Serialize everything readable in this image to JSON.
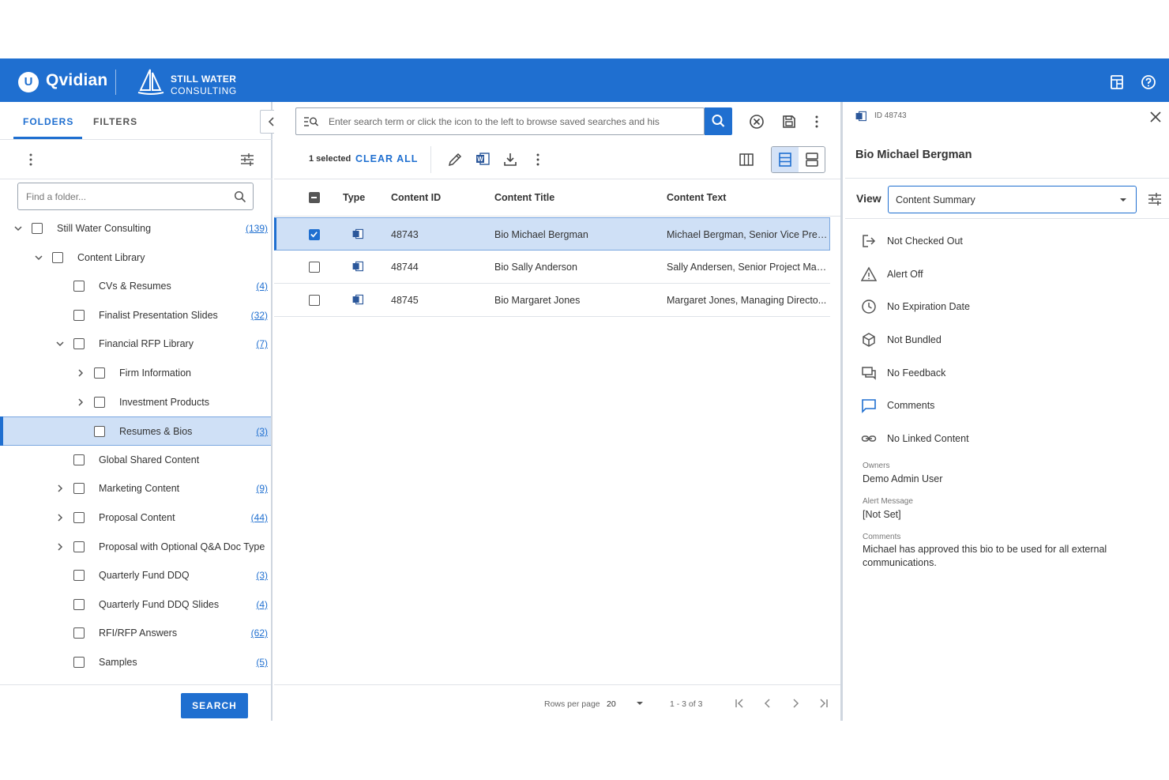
{
  "header": {
    "brand": "Qvidian",
    "logo_letter": "U",
    "partner_line1": "STILL WATER",
    "partner_line2": "CONSULTING",
    "icons": [
      "calculator-icon",
      "help-icon"
    ]
  },
  "left_panel": {
    "tabs": [
      {
        "label": "FOLDERS",
        "active": true
      },
      {
        "label": "FILTERS",
        "active": false
      }
    ],
    "folder_search_placeholder": "Find a folder...",
    "tree": [
      {
        "label": "Still Water Consulting",
        "count": "(139)",
        "level": 0,
        "chevron": "down"
      },
      {
        "label": "Content Library",
        "count": "",
        "level": 1,
        "chevron": "down"
      },
      {
        "label": "CVs & Resumes",
        "count": "(4)",
        "level": 2,
        "chevron": ""
      },
      {
        "label": "Finalist Presentation Slides",
        "count": "(32)",
        "level": 2,
        "chevron": ""
      },
      {
        "label": "Financial RFP Library",
        "count": "(7)",
        "level": 2,
        "chevron": "down"
      },
      {
        "label": "Firm Information",
        "count": "",
        "level": 3,
        "chevron": "right"
      },
      {
        "label": "Investment Products",
        "count": "",
        "level": 3,
        "chevron": "right"
      },
      {
        "label": "Resumes & Bios",
        "count": "(3)",
        "level": 3,
        "chevron": "",
        "selected": true
      },
      {
        "label": "Global Shared Content",
        "count": "",
        "level": 2,
        "chevron": ""
      },
      {
        "label": "Marketing Content",
        "count": "(9)",
        "level": 2,
        "chevron": "right"
      },
      {
        "label": "Proposal Content",
        "count": "(44)",
        "level": 2,
        "chevron": "right"
      },
      {
        "label": "Proposal with Optional Q&A Doc Type",
        "count": "",
        "level": 2,
        "chevron": "right"
      },
      {
        "label": "Quarterly Fund DDQ",
        "count": "(3)",
        "level": 2,
        "chevron": ""
      },
      {
        "label": "Quarterly Fund DDQ Slides",
        "count": "(4)",
        "level": 2,
        "chevron": ""
      },
      {
        "label": "RFI/RFP Answers",
        "count": "(62)",
        "level": 2,
        "chevron": ""
      },
      {
        "label": "Samples",
        "count": "(5)",
        "level": 2,
        "chevron": ""
      }
    ],
    "search_button": "SEARCH"
  },
  "middle_panel": {
    "search_placeholder": "Enter search term or click the icon to the left to browse saved searches and his",
    "selected_text": "1 selected",
    "clear_all": "CLEAR ALL",
    "columns": [
      "Type",
      "Content ID",
      "Content Title",
      "Content Text"
    ],
    "rows": [
      {
        "type_icon": "word-doc-icon",
        "id": "48743",
        "title": "Bio Michael Bergman",
        "text": "Michael Bergman, Senior Vice Pres...",
        "checked": true
      },
      {
        "type_icon": "word-doc-icon",
        "id": "48744",
        "title": "Bio Sally Anderson",
        "text": "Sally Andersen, Senior Project Man...",
        "checked": false
      },
      {
        "type_icon": "word-doc-icon",
        "id": "48745",
        "title": "Bio Margaret Jones",
        "text": "Margaret Jones, Managing Directo...",
        "checked": false
      }
    ],
    "pagination": {
      "rows_per_page_label": "Rows per page",
      "rows_per_page": "20",
      "range": "1 - 3 of 3"
    }
  },
  "right_panel": {
    "id_label": "ID 48743",
    "title": "Bio Michael Bergman",
    "view_label": "View",
    "view_value": "Content Summary",
    "statuses": [
      {
        "icon": "checkout-icon",
        "label": "Not Checked Out"
      },
      {
        "icon": "alert-icon",
        "label": "Alert Off"
      },
      {
        "icon": "clock-icon",
        "label": "No Expiration Date"
      },
      {
        "icon": "bundle-icon",
        "label": "Not Bundled"
      },
      {
        "icon": "feedback-icon",
        "label": "No Feedback"
      },
      {
        "icon": "comment-icon",
        "label": "Comments"
      },
      {
        "icon": "link-icon",
        "label": "No Linked Content"
      }
    ],
    "owners_label": "Owners",
    "owners_value": "Demo Admin User",
    "alert_message_label": "Alert Message",
    "alert_message_value": "[Not Set]",
    "comments_label": "Comments",
    "comments_value": "Michael has approved this bio to be used for all external communications."
  },
  "colors": {
    "brand_blue": "#1f6fd0",
    "selection_bg": "#cfe0f6",
    "border": "#dfe3e8"
  }
}
